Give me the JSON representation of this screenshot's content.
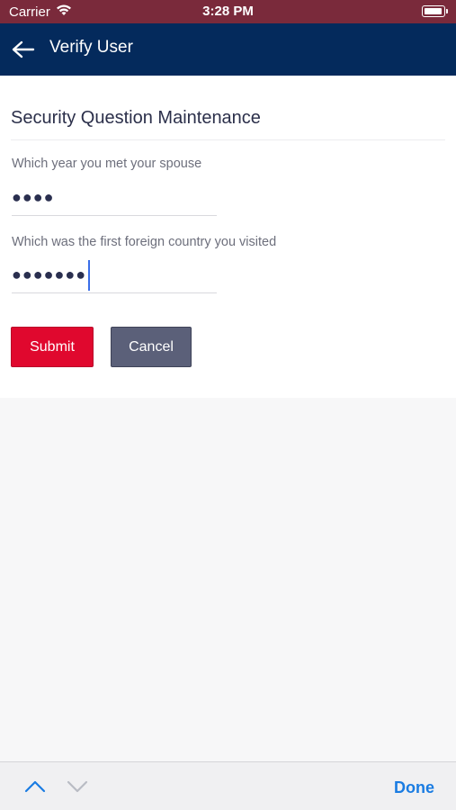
{
  "status_bar": {
    "carrier": "Carrier",
    "time": "3:28 PM"
  },
  "nav": {
    "title": "Verify User"
  },
  "form": {
    "heading": "Security Question Maintenance",
    "questions": [
      {
        "label": "Which year you met your spouse",
        "value": "●●●●"
      },
      {
        "label": "Which was the first foreign country you visited",
        "value": "●●●●●●●"
      }
    ],
    "submit_label": "Submit",
    "cancel_label": "Cancel"
  },
  "toolbar": {
    "done_label": "Done"
  },
  "colors": {
    "status_bar": "#7a2a3b",
    "nav_bar": "#042a5c",
    "submit": "#e0082e",
    "cancel": "#5b6079",
    "done": "#1a7ce2"
  }
}
